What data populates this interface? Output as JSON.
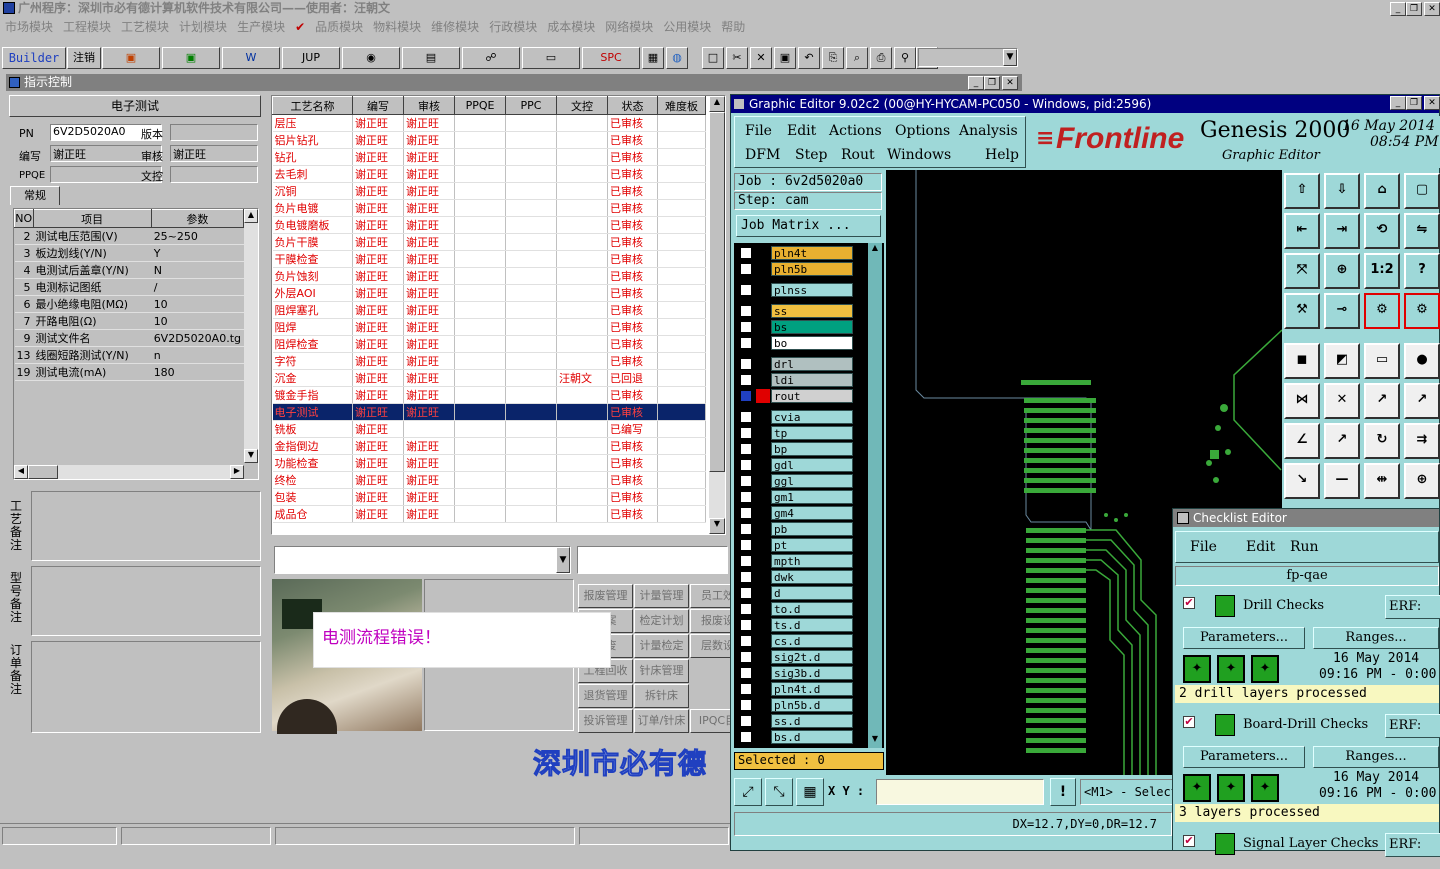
{
  "app": {
    "title": "广州程序：深圳市必有德计算机软件技术有限公司——使用者：汪朝文"
  },
  "menu": [
    "市场模块",
    "工程模块",
    "工艺模块",
    "计划模块",
    "生产模块",
    "品质模块",
    "物料模块",
    "维修模块",
    "行政模块",
    "成本模块",
    "网络模块",
    "公用模块",
    "帮助"
  ],
  "toolbar": {
    "builder": "Builder",
    "logout": "注销",
    "jup": "JUP",
    "spc": "SPC"
  },
  "panel": {
    "title": "指示控制",
    "section": "电子测试",
    "pn_label": "PN",
    "pn_value": "6V2D5020A0",
    "version_label": "版本",
    "editor_label": "编写",
    "editor_value": "谢正旺",
    "review_label": "审核",
    "review_value": "谢正旺",
    "ppqe_label": "PPQE",
    "doc_label": "文控",
    "tab": "常规",
    "params_headers": [
      "NO",
      "项目",
      "参数"
    ],
    "params": [
      [
        "2",
        "测试电压范围(V)",
        "25~250"
      ],
      [
        "3",
        "板边划线(Y/N)",
        "Y"
      ],
      [
        "4",
        "电测试后盖章(Y/N)",
        "N"
      ],
      [
        "5",
        "电测标记图纸",
        "/"
      ],
      [
        "6",
        "最小绝缘电阻(MΩ)",
        "10"
      ],
      [
        "7",
        "开路电阻(Ω)",
        "10"
      ],
      [
        "9",
        "测试文件名",
        "6V2D5020A0.tg"
      ],
      [
        "13",
        "线圈短路测试(Y/N)",
        "n"
      ],
      [
        "19",
        "测试电流(mA)",
        "180"
      ]
    ],
    "remarks": [
      "工艺备注",
      "型号备注",
      "订单备注"
    ]
  },
  "process": {
    "headers": [
      "工艺名称",
      "编写",
      "审核",
      "PPQE",
      "PPC",
      "文控",
      "状态",
      "难度板"
    ],
    "rows": [
      [
        "层压",
        "谢正旺",
        "谢正旺",
        "",
        "",
        "",
        "已审核"
      ],
      [
        "铝片钻孔",
        "谢正旺",
        "谢正旺",
        "",
        "",
        "",
        "已审核"
      ],
      [
        "钻孔",
        "谢正旺",
        "谢正旺",
        "",
        "",
        "",
        "已审核"
      ],
      [
        "去毛刺",
        "谢正旺",
        "谢正旺",
        "",
        "",
        "",
        "已审核"
      ],
      [
        "沉铜",
        "谢正旺",
        "谢正旺",
        "",
        "",
        "",
        "已审核"
      ],
      [
        "负片电镀",
        "谢正旺",
        "谢正旺",
        "",
        "",
        "",
        "已审核"
      ],
      [
        "负电镀磨板",
        "谢正旺",
        "谢正旺",
        "",
        "",
        "",
        "已审核"
      ],
      [
        "负片干膜",
        "谢正旺",
        "谢正旺",
        "",
        "",
        "",
        "已审核"
      ],
      [
        "干膜检查",
        "谢正旺",
        "谢正旺",
        "",
        "",
        "",
        "已审核"
      ],
      [
        "负片蚀刻",
        "谢正旺",
        "谢正旺",
        "",
        "",
        "",
        "已审核"
      ],
      [
        "外层AOI",
        "谢正旺",
        "谢正旺",
        "",
        "",
        "",
        "已审核"
      ],
      [
        "阻焊塞孔",
        "谢正旺",
        "谢正旺",
        "",
        "",
        "",
        "已审核"
      ],
      [
        "阻焊",
        "谢正旺",
        "谢正旺",
        "",
        "",
        "",
        "已审核"
      ],
      [
        "阻焊检查",
        "谢正旺",
        "谢正旺",
        "",
        "",
        "",
        "已审核"
      ],
      [
        "字符",
        "谢正旺",
        "谢正旺",
        "",
        "",
        "",
        "已审核"
      ],
      [
        "沉金",
        "谢正旺",
        "谢正旺",
        "",
        "",
        "汪朝文",
        "已回退"
      ],
      [
        "镀金手指",
        "谢正旺",
        "谢正旺",
        "",
        "",
        "",
        "已审核"
      ],
      [
        "电子测试",
        "谢正旺",
        "谢正旺",
        "",
        "",
        "",
        "已审核"
      ],
      [
        "铣板",
        "谢正旺",
        "",
        "",
        "",
        "",
        "已编写"
      ],
      [
        "金指倒边",
        "谢正旺",
        "谢正旺",
        "",
        "",
        "",
        "已审核"
      ],
      [
        "功能检查",
        "谢正旺",
        "谢正旺",
        "",
        "",
        "",
        "已审核"
      ],
      [
        "终检",
        "谢正旺",
        "谢正旺",
        "",
        "",
        "",
        "已审核"
      ],
      [
        "包装",
        "谢正旺",
        "谢正旺",
        "",
        "",
        "",
        "已审核"
      ],
      [
        "成品仓",
        "谢正旺",
        "谢正旺",
        "",
        "",
        "",
        "已审核"
      ]
    ],
    "selected": 17
  },
  "mgmt_buttons": [
    "报废管理",
    "计量管理",
    "员工效",
    "档案",
    "检定计划",
    "报废设",
    "报废",
    "计量检定",
    "层数设",
    "工程回收",
    "针床管理",
    "退货管理",
    "拆针床",
    "投诉管理",
    "订单/针床",
    "IPQC目"
  ],
  "popup": {
    "message": "电测流程错误！"
  },
  "banner": "深圳市必有德",
  "ge": {
    "title": "Graphic Editor 9.02c2 (00@HY-HYCAM-PC050 - Windows, pid:2596)",
    "menu1": [
      "File",
      "Edit",
      "Actions",
      "Options",
      "Analysis"
    ],
    "menu2": [
      "DFM",
      "Step",
      "Rout",
      "Windows",
      "Help"
    ],
    "brand": "Frontline",
    "product": "Genesis 2000",
    "subtitle": "Graphic Editor",
    "date": "16 May 2014",
    "time": "08:54 PM",
    "job": "Job : 6v2d5020a0",
    "step": "Step: cam",
    "job_matrix": "Job Matrix ...",
    "selected": "Selected : 0",
    "xy": "X Y :",
    "status": "<M1> - Select",
    "dx": "DX=12.7,DY=0,DR=12.7",
    "layers": [
      {
        "n": "pln4t",
        "c": "#e8b030"
      },
      {
        "n": "pln5b",
        "c": "#e8b030"
      },
      {
        "n": "plnss",
        "c": "#9ed8d8"
      },
      {
        "n": "ss",
        "c": "#f0c040"
      },
      {
        "n": "bs",
        "c": "#00a080"
      },
      {
        "n": "bo",
        "c": "#ffffff"
      },
      {
        "n": "drl",
        "c": "#b0c0c0"
      },
      {
        "n": "ldi",
        "c": "#b0c0c0"
      },
      {
        "n": "rout",
        "c": "#d0d0d0"
      },
      {
        "n": "cvia",
        "c": "#9ed8d8"
      },
      {
        "n": "tp",
        "c": "#9ed8d8"
      },
      {
        "n": "bp",
        "c": "#9ed8d8"
      },
      {
        "n": "gdl",
        "c": "#9ed8d8"
      },
      {
        "n": "ggl",
        "c": "#9ed8d8"
      },
      {
        "n": "gm1",
        "c": "#9ed8d8"
      },
      {
        "n": "gm4",
        "c": "#9ed8d8"
      },
      {
        "n": "pb",
        "c": "#9ed8d8"
      },
      {
        "n": "pt",
        "c": "#9ed8d8"
      },
      {
        "n": "mpth",
        "c": "#9ed8d8"
      },
      {
        "n": "dwk",
        "c": "#9ed8d8"
      },
      {
        "n": "d",
        "c": "#9ed8d8"
      },
      {
        "n": "to.d",
        "c": "#9ed8d8"
      },
      {
        "n": "ts.d",
        "c": "#9ed8d8"
      },
      {
        "n": "cs.d",
        "c": "#9ed8d8"
      },
      {
        "n": "sig2t.d",
        "c": "#9ed8d8"
      },
      {
        "n": "sig3b.d",
        "c": "#9ed8d8"
      },
      {
        "n": "pln4t.d",
        "c": "#9ed8d8"
      },
      {
        "n": "pln5b.d",
        "c": "#9ed8d8"
      },
      {
        "n": "ss.d",
        "c": "#9ed8d8"
      },
      {
        "n": "bs.d",
        "c": "#9ed8d8"
      }
    ]
  },
  "checklist": {
    "title": "Checklist Editor",
    "menu": [
      "File",
      "Edit",
      "Run"
    ],
    "name": "fp-qae",
    "erf": "ERF:",
    "params": "Parameters...",
    "ranges": "Ranges...",
    "items": [
      {
        "name": "Drill Checks",
        "date": "16 May 2014",
        "time": "09:16 PM - 0:00",
        "result": "2 drill layers processed"
      },
      {
        "name": "Board-Drill Checks",
        "date": "16 May 2014",
        "time": "09:16 PM - 0:00",
        "result": "3 layers processed"
      },
      {
        "name": "Signal Layer Checks"
      }
    ]
  }
}
